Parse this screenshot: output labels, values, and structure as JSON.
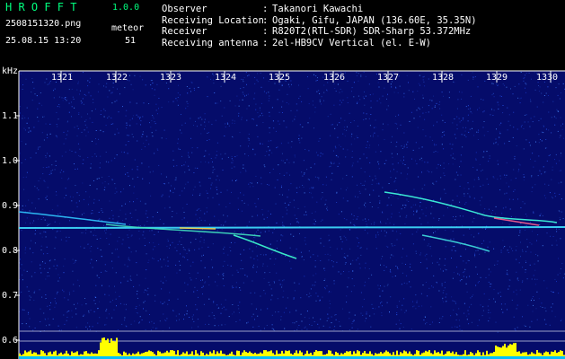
{
  "app": {
    "title": "H R O F F T",
    "version": "1.0.0"
  },
  "file": {
    "name": "2508151320.png",
    "timestamp": "25.08.15 13:20"
  },
  "meteor": {
    "label": "meteor",
    "count": "51"
  },
  "info": {
    "labels": [
      "Observer",
      "Receiving Location",
      "Receiver",
      "Receiving antenna"
    ],
    "colons": [
      ":",
      ":",
      ":",
      ":"
    ],
    "values": [
      "Takanori Kawachi",
      "Ogaki, Gifu, JAPAN (136.60E, 35.35N)",
      "R820T2(RTL-SDR) SDR-Sharp 53.372MHz",
      "2el-HB9CV Vertical (el. E-W)"
    ]
  },
  "axis": {
    "unit": "kHz",
    "y_ticks": [
      "1.1",
      "1.0",
      "0.9",
      "0.8",
      "0.7",
      "0.6"
    ],
    "x_ticks": [
      "1321",
      "1322",
      "1323",
      "1324",
      "1325",
      "1326",
      "1327",
      "1328",
      "1329",
      "1330"
    ]
  },
  "colors": {
    "background": "#050c6a",
    "trace": "#00ffd0",
    "bar": "#ffff00",
    "bar_base": "#00c0ff"
  }
}
